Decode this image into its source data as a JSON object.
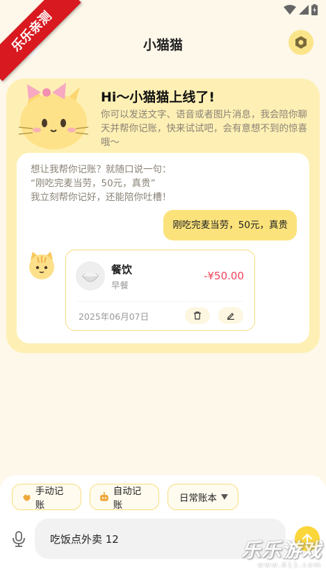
{
  "ribbon": {
    "text": "乐乐亲测"
  },
  "header": {
    "title": "小猫猫"
  },
  "greeting": {
    "title": "Hi～小猫猫上线了!",
    "text": "你可以发送文字、语音或者图片消息，我会陪你聊天并帮你记账，快来试试吧，会有意想不到的惊喜哦～"
  },
  "chat": {
    "hint": "想让我帮你记账？就随口说一句：\n“刚吃完麦当劳，50元，真贵”\n我立刻帮你记好，还能陪你吐槽！",
    "user_message": "刚吃完麦当劳，50元，真贵",
    "record": {
      "category": "餐饮",
      "sub": "早餐",
      "amount": "-¥50.00",
      "date": "2025年06月07日"
    }
  },
  "bottom": {
    "chips": {
      "manual": "手动记账",
      "auto": "自动记账",
      "book": "日常账本"
    },
    "input_value": "吃饭点外卖 12"
  },
  "watermark": {
    "main": "乐乐游戏",
    "url": "www.611.com"
  },
  "colors": {
    "accent": "#fbd63a",
    "card_bg": "#fef0b4",
    "amount": "#f0435a"
  }
}
